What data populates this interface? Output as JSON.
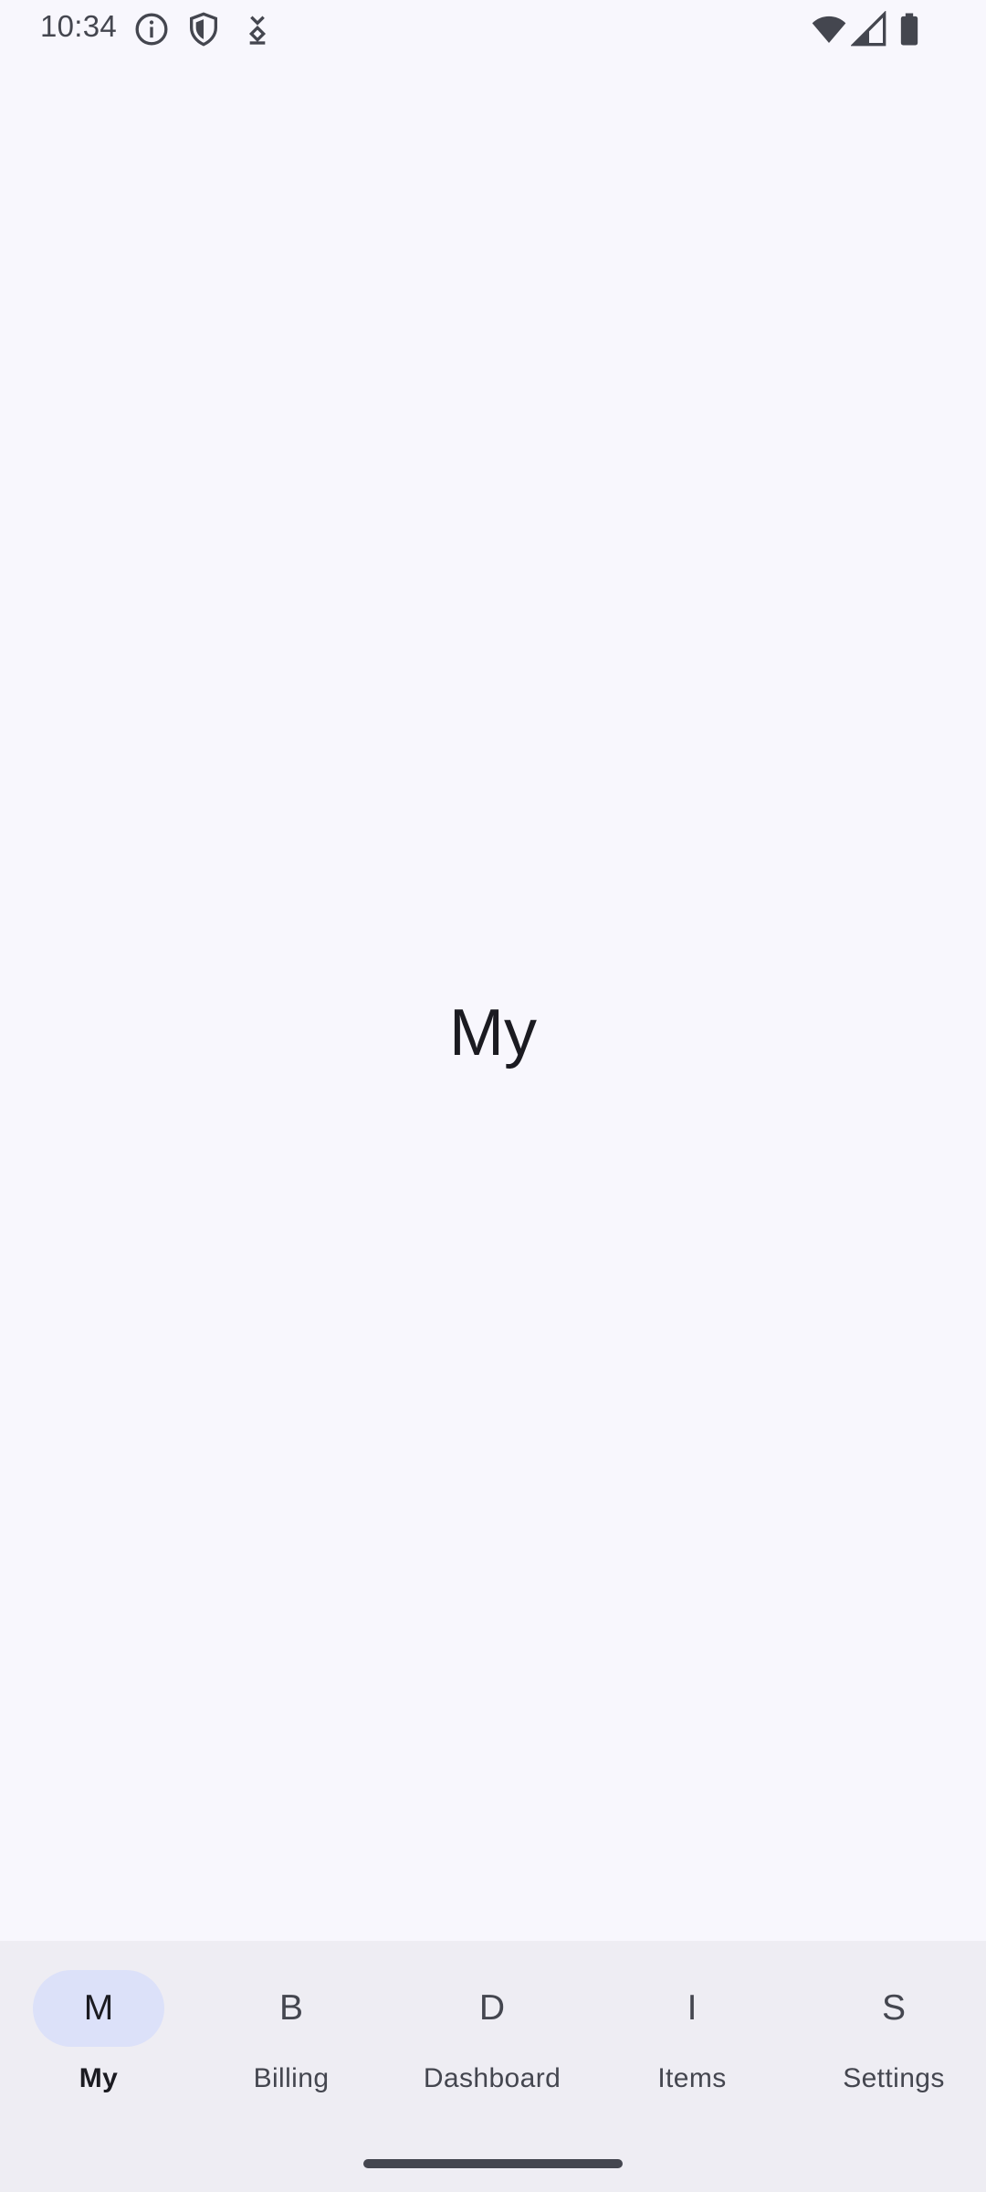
{
  "status_bar": {
    "time": "10:34",
    "left_icons": [
      "info-icon",
      "shield-icon",
      "download-icon"
    ],
    "right_icons": [
      "wifi-icon",
      "cell-signal-icon",
      "battery-icon"
    ]
  },
  "main": {
    "title": "My"
  },
  "bottom_nav": {
    "active_index": 0,
    "items": [
      {
        "icon_letter": "M",
        "label": "My"
      },
      {
        "icon_letter": "B",
        "label": "Billing"
      },
      {
        "icon_letter": "D",
        "label": "Dashboard"
      },
      {
        "icon_letter": "I",
        "label": "Items"
      },
      {
        "icon_letter": "S",
        "label": "Settings"
      }
    ]
  },
  "colors": {
    "background": "#f8f7fd",
    "nav_background": "#eeedf3",
    "active_indicator": "#dce1f9",
    "text_primary": "#1b1b21",
    "text_secondary": "#44464f"
  }
}
